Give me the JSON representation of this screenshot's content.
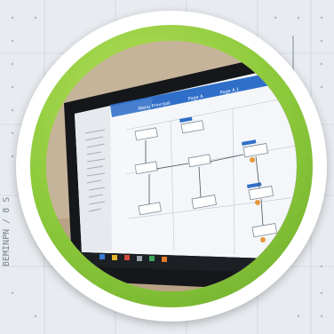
{
  "background": {
    "grid_color": "#b8c3cd",
    "base_color": "#e9edf1",
    "edge_text": "BEMINPN / 8 S"
  },
  "badge": {
    "outer_color": "#ffffff",
    "ring_color": "#8bc83a"
  },
  "photo": {
    "subject": "laptop-screen-showing-flowchart-software",
    "screen_tab_labels": [
      "Menu Principal",
      "Page A",
      "Page A.1"
    ],
    "taskbar_color": "#1c1f24",
    "app_header_color": "#2f6fc9"
  }
}
